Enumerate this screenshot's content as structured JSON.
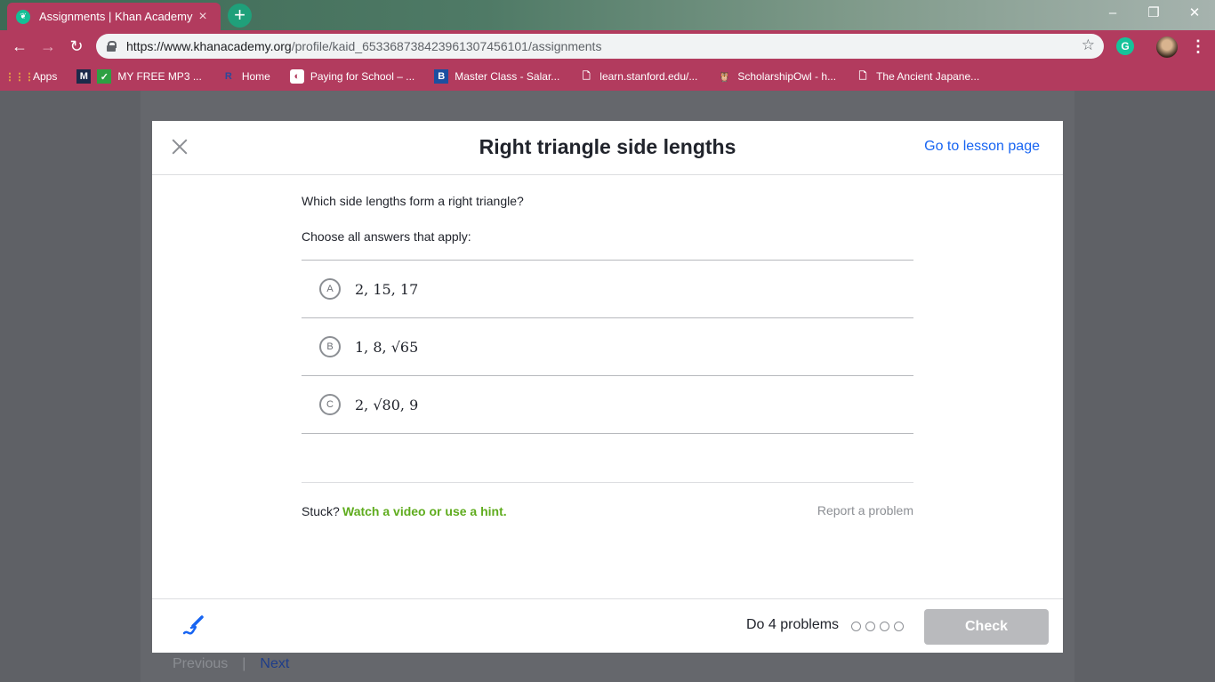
{
  "browser": {
    "tab_title": "Assignments | Khan Academy",
    "tab_close": "×",
    "new_tab": "+",
    "url_host": "https://www.khanacademy.org",
    "url_path": "/profile/kaid_653368738423961307456101/assignments",
    "window_controls": {
      "minimize": "–",
      "restore": "❐",
      "close": "✕"
    },
    "bookmarks": [
      {
        "label": "Apps",
        "icon": "apps-grid-icon"
      },
      {
        "label": "MY FREE MP3 ...",
        "icon": "m-logo-icon"
      },
      {
        "label": "Home",
        "icon": "r-logo-icon"
      },
      {
        "label": "Paying for School – ...",
        "icon": "globe-icon"
      },
      {
        "label": "Master Class - Salar...",
        "icon": "b-logo-icon"
      },
      {
        "label": "learn.stanford.edu/...",
        "icon": "page-icon"
      },
      {
        "label": "ScholarshipOwl - h...",
        "icon": "owl-icon"
      },
      {
        "label": "The Ancient Japane...",
        "icon": "page-icon"
      }
    ]
  },
  "page_nav": {
    "previous": "Previous",
    "separator": "|",
    "next": "Next"
  },
  "modal": {
    "title": "Right triangle side lengths",
    "lesson_link": "Go to lesson page",
    "question": "Which side lengths form a right triangle?",
    "instruction": "Choose all answers that apply:",
    "choices": [
      {
        "letter": "A",
        "text": "2, 15, 17"
      },
      {
        "letter": "B",
        "text": "1, 8, √65"
      },
      {
        "letter": "C",
        "text": "2, √80, 9"
      }
    ],
    "stuck_label": "Stuck?",
    "hint_link": "Watch a video or use a hint.",
    "report_link": "Report a problem",
    "footer": {
      "do_problems": "Do 4 problems",
      "progress_dots": 4,
      "check_label": "Check"
    }
  },
  "colors": {
    "browser_accent": "#b23b5e",
    "link_blue": "#1865f2",
    "hint_green": "#5fac1e",
    "check_disabled": "#b9babd"
  }
}
